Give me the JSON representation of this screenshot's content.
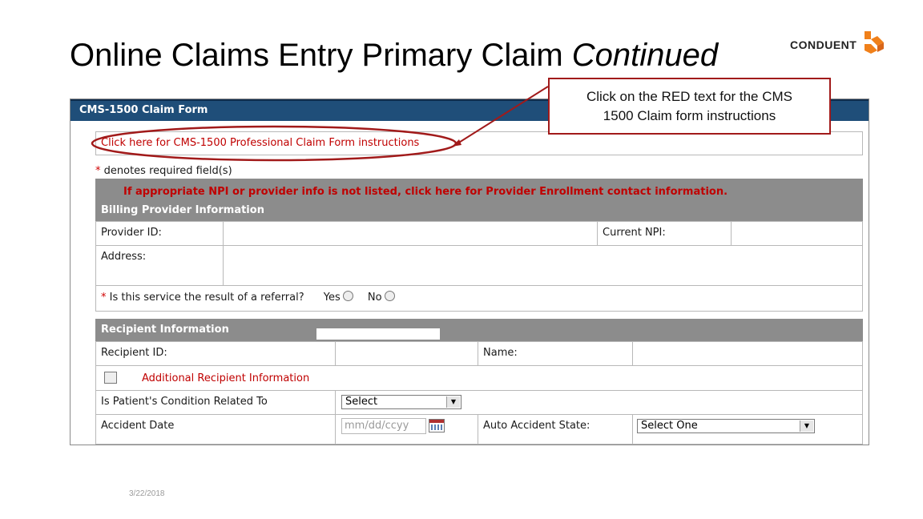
{
  "slide": {
    "title_main": "Online Claims Entry Primary Claim ",
    "title_italic": "Continued",
    "logo_text": "CONDUENT",
    "footer_date": "3/22/2018",
    "callout_line1": "Click on the RED text for the CMS",
    "callout_line2": "1500 Claim form instructions"
  },
  "form": {
    "header": "CMS-1500 Claim Form",
    "instructions_link": "Click here for CMS-1500 Professional Claim Form instructions",
    "required_star": "*",
    "required_note": " denotes required field(s)",
    "npi_note": "If appropriate NPI or provider info is not listed, click here for Provider Enrollment contact information.",
    "billing": {
      "header": "Billing Provider Information",
      "provider_id_label": "Provider ID:",
      "current_npi_label": "Current NPI:",
      "address_label": "Address:",
      "referral_question": " Is this service the result of a referral?",
      "yes_label": "Yes",
      "no_label": "No"
    },
    "recipient": {
      "header": "Recipient Information",
      "recipient_id_label": "Recipient ID:",
      "name_label": "Name:",
      "additional_info": "Additional Recipient Information",
      "condition_label": "Is Patient's Condition Related To",
      "condition_select": "Select",
      "accident_date_label": "Accident Date",
      "accident_date_placeholder": "mm/dd/ccyy",
      "auto_state_label": "Auto Accident State:",
      "auto_state_select": "Select One"
    }
  },
  "colors": {
    "header_blue": "#1f4e79",
    "section_gray": "#8c8c8c",
    "link_red": "#c00000",
    "annotation_red": "#a11a1a",
    "logo_orange": "#f0801a"
  }
}
